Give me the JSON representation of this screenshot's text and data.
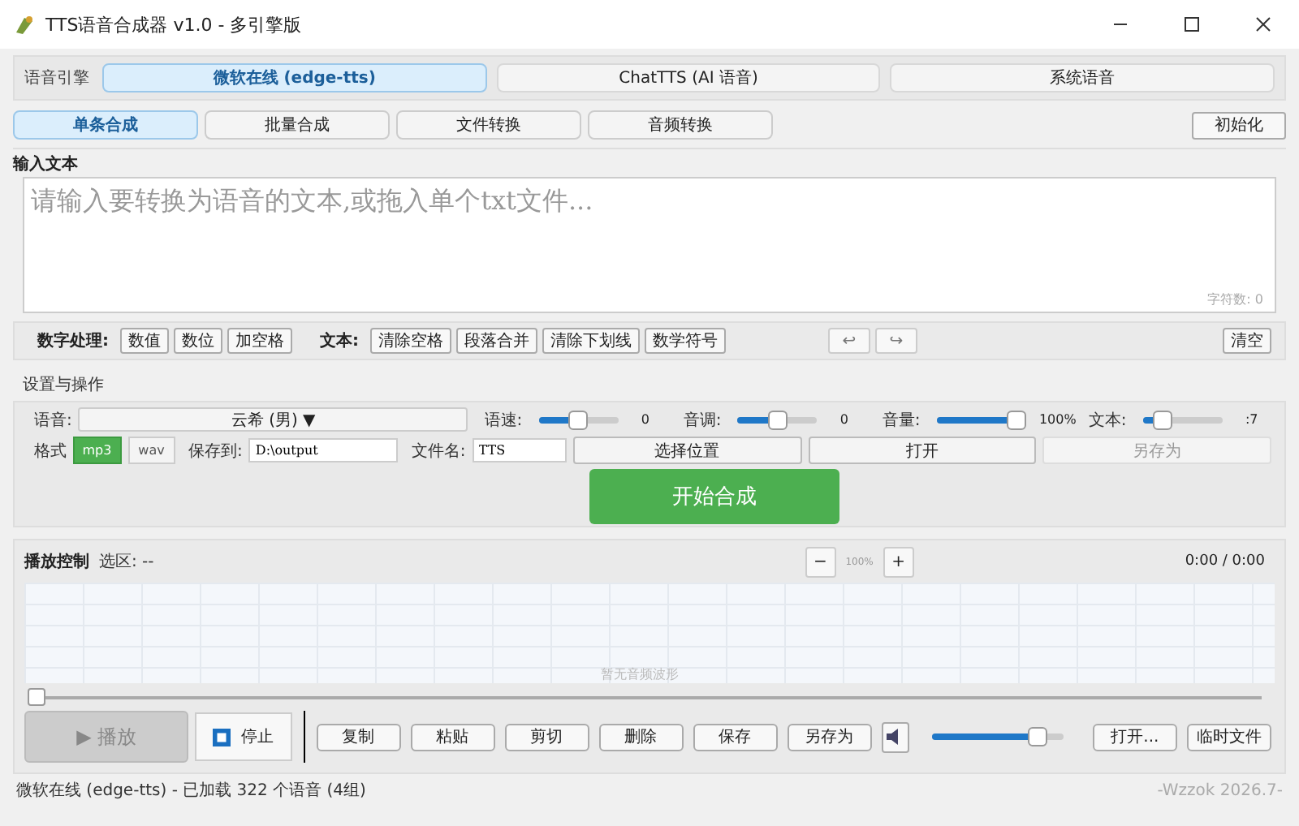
{
  "window": {
    "title": "TTS语音合成器 v1.0 - 多引擎版"
  },
  "engine": {
    "label": "语音引擎",
    "tabs": [
      {
        "label": "微软在线 (edge-tts)",
        "selected": true
      },
      {
        "label": "ChatTTS (AI 语音)",
        "selected": false
      },
      {
        "label": "系统语音",
        "selected": false
      }
    ]
  },
  "mode_tabs": [
    {
      "label": "单条合成",
      "selected": true
    },
    {
      "label": "批量合成",
      "selected": false
    },
    {
      "label": "文件转换",
      "selected": false
    },
    {
      "label": "音频转换",
      "selected": false
    }
  ],
  "init_button": "初始化",
  "input": {
    "label": "输入文本",
    "placeholder": "请输入要转换为语音的文本,或拖入单个txt文件...",
    "char_count": "字符数: 0"
  },
  "tools": {
    "number_label": "数字处理:",
    "number_buttons": [
      "数值",
      "数位",
      "加空格"
    ],
    "text_label": "文本:",
    "text_buttons": [
      "清除空格",
      "段落合并",
      "清除下划线",
      "数学符号"
    ],
    "undo": "↩",
    "redo": "↪",
    "clear": "清空"
  },
  "settings": {
    "title": "设置与操作",
    "voice_label": "语音:",
    "voice": "云希 (男) ▼",
    "sliders": [
      {
        "label": "语速:",
        "level": 0.5,
        "reading": "0"
      },
      {
        "label": "音调:",
        "level": 0.5,
        "reading": "0"
      },
      {
        "label": "音量:",
        "level": 1.0,
        "reading": "100%"
      },
      {
        "label": "文本:",
        "level": 0.25,
        "reading": ":7"
      }
    ],
    "format_label": "格式",
    "formats": [
      {
        "label": "mp3",
        "selected": true
      },
      {
        "label": "wav",
        "selected": false
      }
    ],
    "save_label": "保存到:",
    "save_path": "D:\\output",
    "filename_label": "文件名:",
    "filename": "TTS",
    "actions": [
      {
        "label": "选择位置",
        "disabled": false
      },
      {
        "label": "打开",
        "disabled": false
      },
      {
        "label": "另存为",
        "disabled": true
      }
    ],
    "start": "开始合成"
  },
  "playback": {
    "title": "播放控制",
    "selection": "选区: --",
    "zoom_out": "−",
    "zoom": "100%",
    "zoom_in": "+",
    "time": "0:00 / 0:00",
    "empty": "暂无音频波形",
    "play": {
      "label": "▶ 播放",
      "disabled": true
    },
    "stop": "停止",
    "seek": {
      "level": 0
    },
    "edit_buttons": [
      "复制",
      "粘贴",
      "剪切",
      "删除",
      "保存",
      "另存为"
    ],
    "volume": {
      "level": 0.8
    },
    "open": "打开...",
    "temp": "临时文件"
  },
  "status_bar": {
    "text": "微软在线 (edge-tts) - 已加载 322 个语音 (4组)",
    "credit": "-Wzzok 2026.7-"
  }
}
